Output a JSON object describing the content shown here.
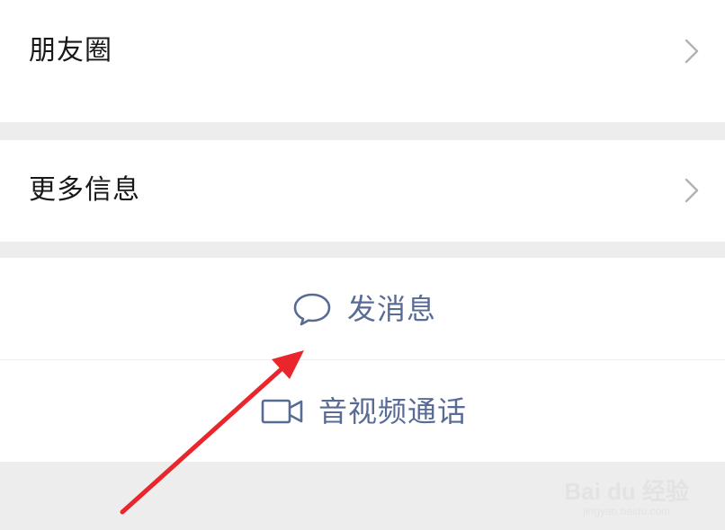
{
  "rows": {
    "moments": {
      "label": "朋友圈"
    },
    "more_info": {
      "label": "更多信息"
    }
  },
  "actions": {
    "send_message": {
      "label": "发消息",
      "icon": "chat-bubble-icon"
    },
    "video_call": {
      "label": "音视频通话",
      "icon": "video-camera-icon"
    }
  },
  "watermark": {
    "brand": "Bai du 经验",
    "url": "jingyan.baidu.com"
  },
  "colors": {
    "background": "#ededed",
    "row_text": "#181818",
    "action_text": "#576b95",
    "arrow": "#e8262b",
    "chevron": "#b2b2b2"
  }
}
